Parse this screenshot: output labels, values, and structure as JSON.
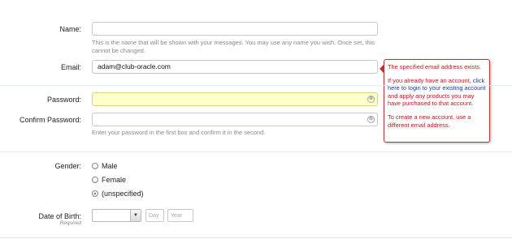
{
  "form": {
    "name": {
      "label": "Name:",
      "value": "",
      "hint": "This is the name that will be shown with your messages. You may use any name you wish. Once set, this cannot be changed."
    },
    "email": {
      "label": "Email:",
      "value": "adam@club-oracle.com"
    },
    "password": {
      "label": "Password:",
      "value": ""
    },
    "confirm_password": {
      "label": "Confirm Password:",
      "value": "",
      "hint": "Enter your password in the first box and confirm it in the second."
    },
    "gender": {
      "label": "Gender:",
      "options": [
        "Male",
        "Female",
        "(unspecified)"
      ],
      "selected": "(unspecified)"
    },
    "dob": {
      "label": "Date of Birth:",
      "required_note": "Required",
      "month_value": "",
      "day_placeholder": "Day",
      "year_placeholder": "Year"
    }
  },
  "email_error": {
    "line1": "The specified email address exists.",
    "line2_before": "If you already have an account, ",
    "line2_link": "click here to login to your existing account",
    "line2_after": " and apply any products you may have purchased to that account.",
    "line3": "To create a new account, use a different email address."
  },
  "colors": {
    "error_text": "#b81c1c",
    "error_border": "#bb3333",
    "link": "#1e3c8e",
    "focused_field": "#ffffcc",
    "separator": "#e3eef3"
  },
  "icons": {
    "password_field_icon": "password-reveal-icon",
    "select_arrow": "chevron-down-icon"
  }
}
